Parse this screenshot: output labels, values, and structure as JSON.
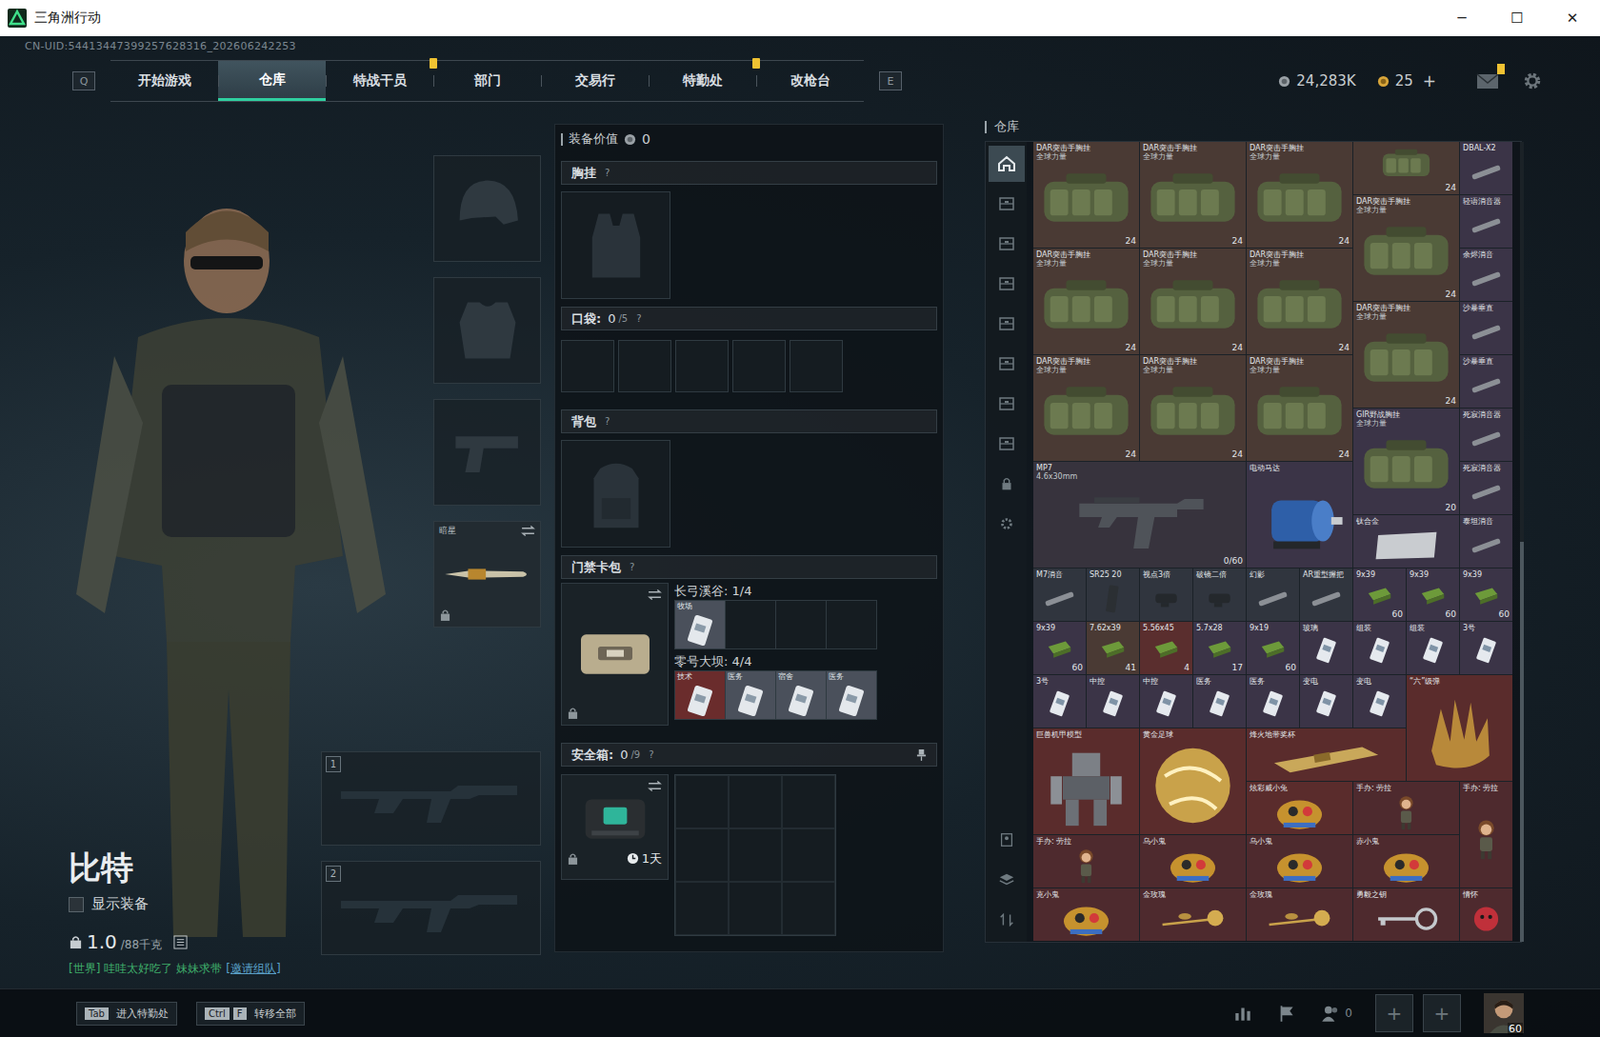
{
  "window": {
    "title": "三角洲行动",
    "controls": [
      "─",
      "☐",
      "✕"
    ]
  },
  "uid": "CN-UID:54413447399257628316_202606242253",
  "nav": {
    "left_key": "Q",
    "right_key": "E",
    "tabs": [
      {
        "label": "开始游戏",
        "selected": false,
        "badge": false
      },
      {
        "label": "仓库",
        "selected": true,
        "badge": false
      },
      {
        "label": "特战干员",
        "selected": false,
        "badge": true
      },
      {
        "label": "部门",
        "selected": false,
        "badge": false
      },
      {
        "label": "交易行",
        "selected": false,
        "badge": false
      },
      {
        "label": "特勤处",
        "selected": false,
        "badge": true
      },
      {
        "label": "改枪台",
        "selected": false,
        "badge": false
      }
    ]
  },
  "wallet": {
    "coins": "24,283K",
    "tickets": "25",
    "add": "+"
  },
  "mail": {
    "badge": true
  },
  "character": {
    "name": "比特",
    "show_equipment": {
      "label": "显示装备",
      "checked": false
    },
    "weight": "1.0",
    "weight_max": "/88千克",
    "chat": {
      "channel": "[世界]",
      "message": "哇哇太好吃了 妹妹求带",
      "link": "[邀请组队]"
    }
  },
  "gear_slots": [
    {
      "kind": "helmet",
      "filled": false,
      "locked": false
    },
    {
      "kind": "armor",
      "filled": false,
      "locked": false
    },
    {
      "kind": "pistol",
      "filled": false,
      "locked": false
    },
    {
      "kind": "melee",
      "filled": true,
      "locked": true,
      "label": "暗星"
    }
  ],
  "weapon_slots": [
    {
      "number": "1"
    },
    {
      "number": "2"
    }
  ],
  "loadout": {
    "value_label": "装备价值",
    "value": "0",
    "chest": {
      "title": "胸挂",
      "help": "?"
    },
    "pockets": {
      "title": "口袋:",
      "count": "0",
      "capacity": "/5",
      "help": "?",
      "slots": [
        false,
        false,
        false,
        false,
        false
      ]
    },
    "backpack": {
      "title": "背包",
      "help": "?"
    },
    "keycards": {
      "title": "门禁卡包",
      "help": "?",
      "locked": true,
      "maps": [
        {
          "name": "长弓溪谷: 1/4",
          "cards": [
            {
              "label": "牧场",
              "filled": true,
              "color": "#4a505b"
            },
            {
              "filled": false
            },
            {
              "filled": false
            },
            {
              "filled": false
            }
          ]
        },
        {
          "name": "零号大坝: 4/4",
          "cards": [
            {
              "label": "技术",
              "filled": true,
              "color": "#6a2c2c"
            },
            {
              "label": "医务",
              "filled": true,
              "color": "#4a505b"
            },
            {
              "label": "宿舍",
              "filled": true,
              "color": "#4a505b"
            },
            {
              "label": "医务",
              "filled": true,
              "color": "#4a505b"
            }
          ]
        }
      ]
    },
    "safe": {
      "title": "安全箱:",
      "count": "0",
      "capacity": "/9",
      "help": "?",
      "timer": "1天",
      "locked": true,
      "cells": [
        false,
        false,
        false,
        false,
        false,
        false,
        false,
        false,
        false
      ]
    }
  },
  "warehouse": {
    "title": "仓库",
    "side_tabs": [
      {
        "selected": true
      },
      {
        "selected": false
      },
      {
        "selected": false
      },
      {
        "selected": false
      },
      {
        "selected": false
      },
      {
        "selected": false
      },
      {
        "selected": false
      },
      {
        "selected": false
      }
    ],
    "items": [
      {
        "name": "DAR突击手胸挂",
        "sub": "全球力量",
        "count": "24",
        "kind": "vest",
        "color": "#4a3a34"
      },
      {
        "name": "DAR突击手胸挂",
        "sub": "全球力量",
        "count": "24",
        "kind": "vest",
        "color": "#4a3a34"
      },
      {
        "name": "DAR突击手胸挂",
        "sub": "全球力量",
        "count": "24",
        "kind": "vest",
        "color": "#4a3a34"
      },
      {
        "count": "24",
        "kind": "strip",
        "color": "#4a3a34"
      },
      {
        "name": "DBAL-X2",
        "kind": "part",
        "color": "#3b3447"
      },
      {
        "name": "DAR突击手胸挂",
        "sub": "全球力量",
        "count": "24",
        "kind": "vest",
        "color": "#4a3a34"
      },
      {
        "name": "轻语消音器",
        "kind": "part",
        "color": "#3b3447"
      },
      {
        "name": "DAR突击手胸挂",
        "sub": "全球力量",
        "count": "24",
        "kind": "vest",
        "color": "#4a3a34"
      },
      {
        "name": "DAR突击手胸挂",
        "sub": "全球力量",
        "count": "24",
        "kind": "vest",
        "color": "#4a3a34"
      },
      {
        "name": "DAR突击手胸挂",
        "sub": "全球力量",
        "count": "24",
        "kind": "vest",
        "color": "#4a3a34"
      },
      {
        "name": "余烬消音",
        "kind": "part",
        "color": "#3b3447"
      },
      {
        "name": "DAR突击手胸挂",
        "sub": "全球力量",
        "count": "24",
        "kind": "vest",
        "color": "#4a3a34"
      },
      {
        "name": "沙暴垂直",
        "kind": "part",
        "color": "#3b3447"
      },
      {
        "name": "DAR突击手胸挂",
        "sub": "全球力量",
        "count": "24",
        "kind": "vest",
        "color": "#4a3a34"
      },
      {
        "name": "DAR突击手胸挂",
        "sub": "全球力量",
        "count": "24",
        "kind": "vest",
        "color": "#4a3a34"
      },
      {
        "name": "DAR突击手胸挂",
        "sub": "全球力量",
        "count": "24",
        "kind": "vest",
        "color": "#4a3a34"
      },
      {
        "name": "沙暴垂直",
        "kind": "part",
        "color": "#3b3447"
      },
      {
        "name": "GIR野战胸挂",
        "sub": "全球力量",
        "count": "20",
        "kind": "vest",
        "color": "#3b3447"
      },
      {
        "name": "死寂消音器",
        "kind": "part",
        "color": "#3b3447"
      },
      {
        "name": "MP7",
        "sub": "4.6x30mm",
        "count": "0/60",
        "kind": "gun",
        "color": "#37333d"
      },
      {
        "name": "电动马达",
        "kind": "motor",
        "color": "#3b3447"
      },
      {
        "name": "死寂消音器",
        "kind": "part",
        "color": "#3b3447"
      },
      {
        "name": "钛合金",
        "kind": "plate",
        "color": "#3b3447"
      },
      {
        "name": "泰坦消音",
        "kind": "part",
        "color": "#3b3447"
      },
      {
        "name": "M7消音",
        "kind": "part",
        "color": "#30353e"
      },
      {
        "name": "SR25 20",
        "kind": "mag",
        "color": "#30353e"
      },
      {
        "name": "视点3倍",
        "kind": "scope",
        "color": "#30353e"
      },
      {
        "name": "破镜二倍",
        "kind": "scope",
        "color": "#30353e"
      },
      {
        "name": "幻影",
        "kind": "part",
        "color": "#30353e"
      },
      {
        "name": "AR重型握把",
        "kind": "part",
        "color": "#30353e"
      },
      {
        "name": "9x39",
        "count": "60",
        "kind": "ammo",
        "color": "#3b3447"
      },
      {
        "name": "9x39",
        "count": "60",
        "kind": "ammo",
        "color": "#3b3447"
      },
      {
        "name": "9x39",
        "count": "60",
        "kind": "ammo",
        "color": "#3b3447"
      },
      {
        "name": "9x39",
        "count": "60",
        "kind": "ammo",
        "color": "#3b3447"
      },
      {
        "name": "7.62x39",
        "count": "41",
        "kind": "ammo",
        "color": "#4a3a34"
      },
      {
        "name": "5.56x45",
        "count": "4",
        "kind": "ammo",
        "color": "#5a2e2e"
      },
      {
        "name": "5.7x28",
        "count": "17",
        "kind": "ammo",
        "color": "#3b3447"
      },
      {
        "name": "9x19",
        "count": "60",
        "kind": "ammo",
        "color": "#3b3447"
      },
      {
        "name": "玻璃",
        "kind": "card",
        "color": "#3b3447"
      },
      {
        "name": "组装",
        "kind": "card",
        "color": "#3b3447"
      },
      {
        "name": "组装",
        "kind": "card",
        "color": "#3b3447"
      },
      {
        "name": "3号",
        "kind": "card",
        "color": "#3b3447"
      },
      {
        "name": "3号",
        "kind": "card",
        "color": "#3b3447"
      },
      {
        "name": "中控",
        "kind": "card",
        "color": "#3b3447"
      },
      {
        "name": "中控",
        "kind": "card",
        "color": "#3b3447"
      },
      {
        "name": "医务",
        "kind": "card",
        "color": "#3b3447"
      },
      {
        "name": "医务",
        "kind": "card",
        "color": "#3b3447"
      },
      {
        "name": "变电",
        "kind": "card",
        "color": "#3b3447"
      },
      {
        "name": "变电",
        "kind": "card",
        "color": "#3b3447"
      },
      {
        "name": "“六”级弹",
        "kind": "glove",
        "color": "#5a2c2c"
      },
      {
        "name": "巨兽机甲模型",
        "kind": "mech",
        "color": "#5a2c2c"
      },
      {
        "name": "黄金足球",
        "kind": "ball",
        "color": "#5a2c2c"
      },
      {
        "name": "烽火地带奖杯",
        "kind": "trophy",
        "color": "#5a2c2c"
      },
      {
        "name": "炫彩威小兔",
        "kind": "toy",
        "color": "#5a2c2c"
      },
      {
        "name": "手办: 劳拉",
        "kind": "figure",
        "color": "#4e2a2e"
      },
      {
        "name": "手办: 劳拉",
        "kind": "tall",
        "color": "#4e2a2e"
      },
      {
        "name": "手办: 劳拉",
        "kind": "figure",
        "color": "#4e2a2e"
      },
      {
        "name": "乌小鬼",
        "kind": "toy",
        "color": "#4e2a2e"
      },
      {
        "name": "乌小鬼",
        "kind": "toy",
        "color": "#4e2a2e"
      },
      {
        "name": "赤小鬼",
        "kind": "toy",
        "color": "#4e2a2e"
      },
      {
        "name": "克小鬼",
        "kind": "toy",
        "color": "#4e2a2e"
      },
      {
        "name": "金玫瑰",
        "kind": "rose",
        "color": "#4e2a2e"
      },
      {
        "name": "金玫瑰",
        "kind": "rose",
        "color": "#4e2a2e"
      },
      {
        "name": "勇毅之钥",
        "kind": "key",
        "color": "#4e2a2e"
      },
      {
        "name": "情怀",
        "kind": "mask",
        "color": "#4e2a2e"
      }
    ]
  },
  "bottom": {
    "hints": [
      {
        "keys": [
          "Tab"
        ],
        "label": "进入特勤处"
      },
      {
        "keys": [
          "Ctrl",
          "F"
        ],
        "label": "转移全部"
      }
    ],
    "team_count": "0",
    "invite_slots": [
      "+",
      "+"
    ],
    "level": "60"
  }
}
